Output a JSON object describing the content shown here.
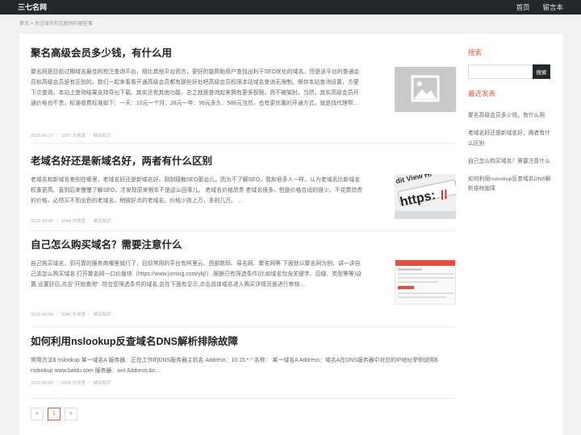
{
  "header": {
    "site_name": "三七名网",
    "nav": [
      "首页",
      "留言本"
    ]
  },
  "breadcrumb": "首页 > 关注域名和互联网的那些事",
  "posts": [
    {
      "title": "聚名高级会员多少钱，有什么用",
      "excerpt": "聚名网是目前过期域名最佳的抢注查询平台，相比其他平台而言，更好的能帮助用户查找出利于SEO优化的域名。但是该平台的普通会员和高级会员是有区别的。我们一起来看看开通高级会员都有那些好处吧高级会员权限本站域名查询无限制。保存本站查询设置，方便下次查询。本站上查询结果支持导出下载。其实还有其他功能，总之就是查询起来拥有更多权限，而不被架肘。当然，其实高级会员开通价格也不贵，标准收费标准如下：一天：10元一个月：28元一年：98元永久：588元当然，也有更优惠的开通方式，就是找代理帮...",
      "date": "2023-06-27",
      "views": "3397 次浏览",
      "category": "域名知识",
      "thumb": "image-placeholder"
    },
    {
      "title": "老域名好还是新域名好，两者有什么区别",
      "excerpt": "老域名和新域名差别在哪里，老域名好还是新域名好。刚刚接触SEO那会儿，因为不了解SEO，我和很多人一样，认为老域名比新域名权重更高。直到后来慢慢了解SEO，才发现原来根本不是这么回事儿。 老域名价格昂贵  老域名很多，但是价格合适的很少。不花费昂贵的价格，必然买不到出色的老域名，稍微好点的老域名，价格少则上万，多则几万。 ...",
      "date": "2022-09-06",
      "views": "3344 次浏览",
      "category": "域名知识",
      "thumb": "https-url"
    },
    {
      "title": "自己怎么购买域名？需要注意什么",
      "excerpt": "自己购买域名，到可靠的服务商哪里就行了，目前常用的平台有阿里云、西部数码、易名网、聚名网等 下面就以聚名网为例，讲一讲自己该怎么购买域名 打开聚名网一口价版块（https://www.juming.com/ykj/）,根据已有筛选条件(比如域名包含关键字、后缀、类型等等)设置,设置好后,点击\"开始查询\". 符合您筛选条件的域名,会在下面有显示,点击具体域名进入购买详情页面进行审核:...",
      "date": "2022-09-06",
      "views": "3040 次浏览",
      "category": "域名知识",
      "thumb": "screenshot"
    },
    {
      "title": "如何利用nslookup反查域名DNS解析排除故障",
      "excerpt": "常用方法$ nslookup 某一域名A 服务器：正在工作的DNS服务器主机名 Address：10.15.*.* 名称：  某一域名A Address：域名A在DNS服务器中对应的IP地址举例说明$ nslookup www.baidu.com 服务器：xxx Address:&n...",
      "date": "2022-09-05",
      "views": "2858 次浏览",
      "category": "域名知识",
      "thumb": ""
    }
  ],
  "pagination": {
    "prev": "«",
    "current": "1",
    "next": "»"
  },
  "sidebar": {
    "search_title": "搜索",
    "search_button": "搜索",
    "search_placeholder": "",
    "recent_title": "最近发表",
    "recent": [
      "聚名高级会员多少钱，有什么用",
      "老域名好还是新域名好，两者有什么区别",
      "自己怎么购买域名？需要注意什么",
      "如何利用nslookup反查域名DNS解析排除故障"
    ]
  },
  "colors": {
    "topbar": "#23282d",
    "accent": "#e8553e",
    "background": "#f1f1f1"
  }
}
